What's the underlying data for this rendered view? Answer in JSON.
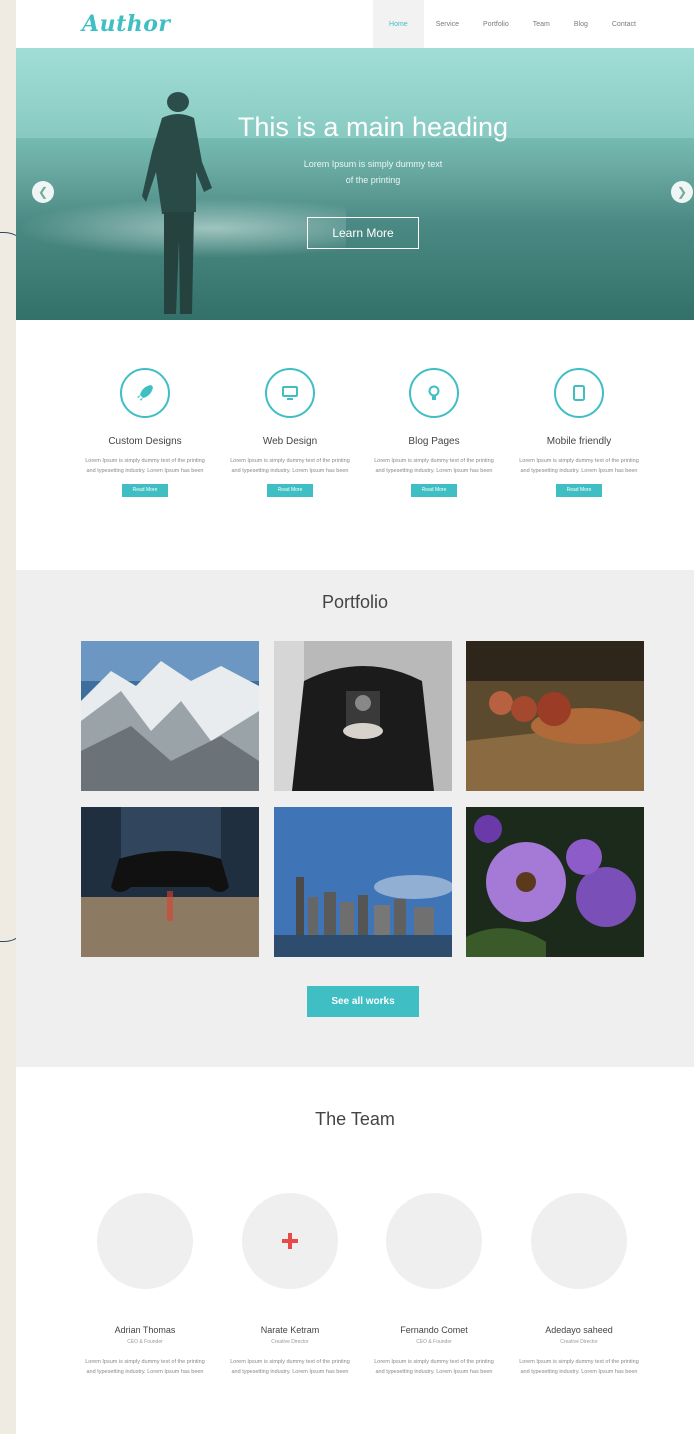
{
  "brand": {
    "logo": "Author",
    "accent": "#3fbfc4"
  },
  "nav": {
    "items": [
      "Home",
      "Service",
      "Portfolio",
      "Team",
      "Blog",
      "Contact"
    ],
    "active": "Home"
  },
  "hero": {
    "title": "This is a main heading",
    "subtitle_line1": "Lorem Ipsum is simply dummy text",
    "subtitle_line2": "of the printing",
    "button": "Learn More",
    "prev_icon": "chevron-left-icon",
    "next_icon": "chevron-right-icon"
  },
  "services": [
    {
      "icon": "rocket-icon",
      "title": "Custom Designs",
      "text": "Lorem Ipsum is simply dummy text of the printing and typesetting industry. Lorem Ipsum has been",
      "button": "Read More"
    },
    {
      "icon": "monitor-icon",
      "title": "Web Design",
      "text": "Lorem Ipsum is simply dummy text of the printing and typesetting industry. Lorem Ipsum has been",
      "button": "Read More"
    },
    {
      "icon": "lightbulb-icon",
      "title": "Blog Pages",
      "text": "Lorem Ipsum is simply dummy text of the printing and typesetting industry. Lorem Ipsum has been",
      "button": "Read More"
    },
    {
      "icon": "tablet-icon",
      "title": "Mobile friendly",
      "text": "Lorem Ipsum is simply dummy text of the printing and typesetting industry. Lorem Ipsum has been",
      "button": "Read More"
    }
  ],
  "portfolio": {
    "title": "Portfolio",
    "items": [
      "mountains",
      "camera",
      "baseball-glove",
      "game-controller",
      "city-skyline",
      "purple-flowers"
    ],
    "button": "See all works"
  },
  "team": {
    "title": "The Team",
    "members": [
      {
        "name": "Adrian Thomas",
        "role": "CEO & Founder",
        "text": "Lorem Ipsum is simply dummy text of the printing and typesetting industry. Lorem Ipsum has been"
      },
      {
        "name": "Narate Ketram",
        "role": "Creative Director",
        "text": "Lorem Ipsum is simply dummy text of the printing and typesetting industry. Lorem Ipsum has been"
      },
      {
        "name": "Fernando Comet",
        "role": "CEO & Founder",
        "text": "Lorem Ipsum is simply dummy text of the printing and typesetting industry. Lorem Ipsum has been"
      },
      {
        "name": "Adedayo saheed",
        "role": "Creative Director",
        "text": "Lorem Ipsum is simply dummy text of the printing and typesetting industry. Lorem Ipsum has been"
      }
    ],
    "plus_icon": "plus-icon"
  }
}
